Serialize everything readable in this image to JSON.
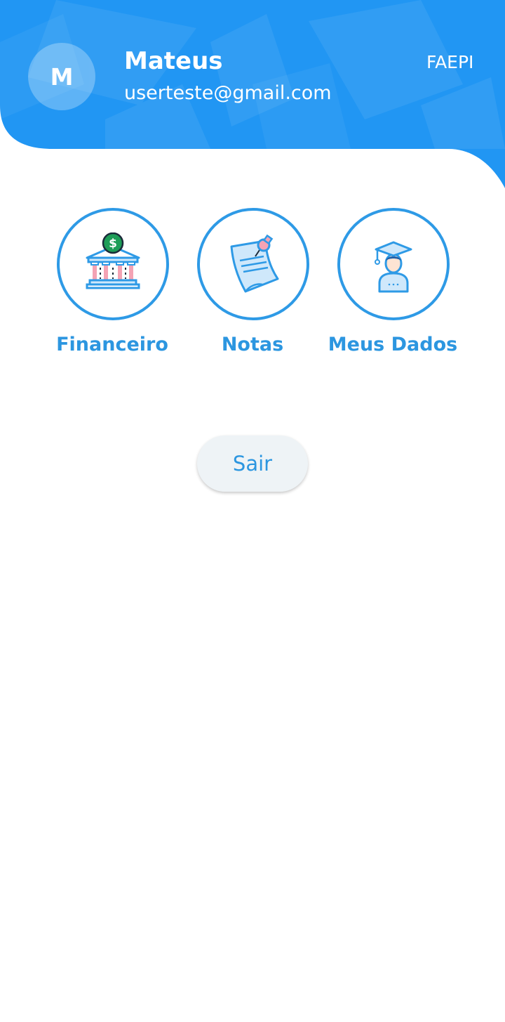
{
  "header": {
    "avatar_initial": "M",
    "user_name": "Mateus",
    "user_email": "userteste@gmail.com",
    "institution": "FAEPI"
  },
  "menu": [
    {
      "label": "Financeiro",
      "icon": "bank-money-icon"
    },
    {
      "label": "Notas",
      "icon": "pinned-note-icon"
    },
    {
      "label": "Meus Dados",
      "icon": "graduate-student-icon"
    }
  ],
  "logout": {
    "label": "Sair"
  },
  "colors": {
    "header_blue": "#2196f3",
    "accent_blue": "#2c96e0",
    "button_bg": "#eef3f6"
  }
}
